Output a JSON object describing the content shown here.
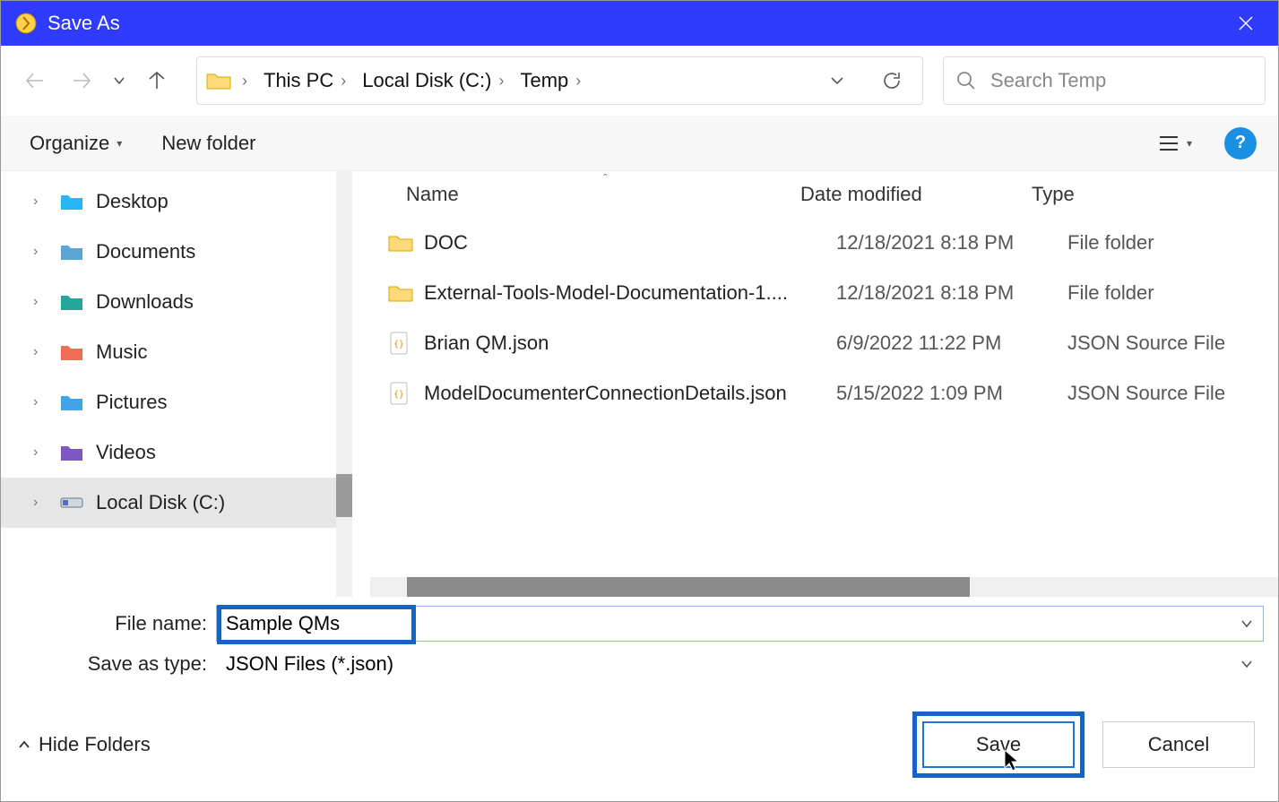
{
  "window": {
    "title": "Save As"
  },
  "breadcrumb": [
    "This PC",
    "Local Disk (C:)",
    "Temp"
  ],
  "search": {
    "placeholder": "Search Temp"
  },
  "toolbar": {
    "organize": "Organize",
    "new_folder": "New folder"
  },
  "tree": {
    "items": [
      {
        "label": "Desktop",
        "ic": "desktop"
      },
      {
        "label": "Documents",
        "ic": "documents"
      },
      {
        "label": "Downloads",
        "ic": "downloads"
      },
      {
        "label": "Music",
        "ic": "music"
      },
      {
        "label": "Pictures",
        "ic": "pictures"
      },
      {
        "label": "Videos",
        "ic": "videos"
      },
      {
        "label": "Local Disk (C:)",
        "ic": "disk",
        "selected": true
      }
    ]
  },
  "columns": {
    "name": "Name",
    "date": "Date modified",
    "type": "Type"
  },
  "rows": [
    {
      "ic": "folder",
      "name": "DOC",
      "date": "12/18/2021 8:18 PM",
      "type": "File folder"
    },
    {
      "ic": "folder",
      "name": "External-Tools-Model-Documentation-1....",
      "date": "12/18/2021 8:18 PM",
      "type": "File folder"
    },
    {
      "ic": "json",
      "name": "Brian QM.json",
      "date": "6/9/2022 11:22 PM",
      "type": "JSON Source File"
    },
    {
      "ic": "json",
      "name": "ModelDocumenterConnectionDetails.json",
      "date": "5/15/2022 1:09 PM",
      "type": "JSON Source File"
    }
  ],
  "file_name_label": "File name:",
  "file_name_value": "Sample QMs",
  "save_type_label": "Save as type:",
  "save_type_value": "JSON Files (*.json)",
  "footer": {
    "hide_folders": "Hide Folders",
    "save": "Save",
    "cancel": "Cancel"
  },
  "help_glyph": "?"
}
